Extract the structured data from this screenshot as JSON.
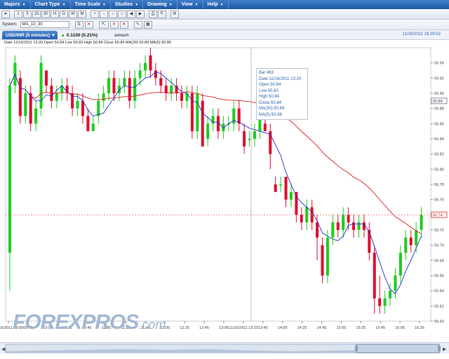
{
  "menu": {
    "items": [
      "Majors",
      "Chart Type",
      "Time Scale",
      "Studies",
      "Drawing",
      "View",
      "Help"
    ]
  },
  "toolbar": {
    "buttons": [
      "1",
      "5",
      "15",
      "30",
      "H",
      "D",
      "W",
      "M"
    ]
  },
  "system": {
    "label": "System:",
    "value": "MA_10_30"
  },
  "tabs": {
    "symbol": "USD/INR (5 minutes)",
    "change": "0.1100 (0.21%)",
    "user": "avinash",
    "timestamp": "11/16/2011 16:29:02"
  },
  "legend": {
    "text": "Date 11/16/2011 13:20  Open 50.84  Low 50.83  High 50.84  Close 50.84  MA(30) 50.89  MA(5) 50.86"
  },
  "tooltip": {
    "bar": "Bar:463",
    "date": "Date:11/16/2011 13:20",
    "open": "Open:50.84",
    "low": "Low:50.83",
    "high": "High:50.84",
    "close": "Close:50.84",
    "ma30": "MA(30):50.89",
    "ma5": "MA(5):50.86"
  },
  "logo": {
    "brand": "FOREXPROS",
    "suffix": ".com"
  },
  "chart_data": {
    "type": "candlestick",
    "y_axis_ticks": [
      "50.94",
      "50.92",
      "50.90",
      "50.88",
      "50.86",
      "50.84",
      "50.82",
      "50.80",
      "50.78",
      "50.76",
      "50.74",
      "50.72",
      "50.70",
      "50.68",
      "50.66",
      "50.64",
      "50.62",
      "50.60"
    ],
    "ylim": [
      50.6,
      50.96
    ],
    "current_price": "50.74",
    "crosshair_price": "50.89",
    "x_tick_labels": [
      "11/16/2011 09:00",
      "09:45",
      "10:05",
      "10:25",
      "10:45",
      "11:05",
      "11:25",
      "11:45",
      "12:05",
      "12:25",
      "12:45",
      "13:05",
      "11/16/2011 13:20",
      "13:45",
      "14:05",
      "14:25",
      "14:45",
      "15:05",
      "15:25",
      "15:45",
      "16:05",
      "16:25"
    ],
    "colors": {
      "up": "#22cc22",
      "down": "#dd1133",
      "ma5": "#2233cc",
      "ma30": "#dd2222"
    },
    "candles": [
      [
        50.69,
        50.91,
        50.64,
        50.92
      ],
      [
        50.91,
        50.94,
        50.9,
        50.95
      ],
      [
        50.92,
        50.87,
        50.86,
        50.93
      ],
      [
        50.87,
        50.9,
        50.86,
        50.91
      ],
      [
        50.9,
        50.86,
        50.85,
        50.91
      ],
      [
        50.86,
        50.88,
        50.85,
        50.89
      ],
      [
        50.88,
        50.94,
        50.87,
        50.95
      ],
      [
        50.93,
        50.91,
        50.9,
        50.93
      ],
      [
        50.91,
        50.89,
        50.88,
        50.92
      ],
      [
        50.89,
        50.9,
        50.88,
        50.91
      ],
      [
        50.9,
        50.91,
        50.89,
        50.92
      ],
      [
        50.91,
        50.9,
        50.89,
        50.92
      ],
      [
        50.9,
        50.88,
        50.87,
        50.91
      ],
      [
        50.88,
        50.89,
        50.87,
        50.9
      ],
      [
        50.89,
        50.87,
        50.86,
        50.9
      ],
      [
        50.87,
        50.85,
        50.85,
        50.88
      ],
      [
        50.85,
        50.86,
        50.85,
        50.87
      ],
      [
        50.87,
        50.89,
        50.86,
        50.9
      ],
      [
        50.89,
        50.9,
        50.88,
        50.91
      ],
      [
        50.9,
        50.92,
        50.89,
        50.93
      ],
      [
        50.92,
        50.9,
        50.89,
        50.93
      ],
      [
        50.9,
        50.91,
        50.89,
        50.92
      ],
      [
        50.91,
        50.92,
        50.9,
        50.93
      ],
      [
        50.92,
        50.89,
        50.88,
        50.93
      ],
      [
        50.89,
        50.92,
        50.88,
        50.93
      ],
      [
        50.92,
        50.93,
        50.91,
        50.94
      ],
      [
        50.93,
        50.94,
        50.92,
        50.95
      ],
      [
        50.95,
        50.93,
        50.92,
        50.96
      ],
      [
        50.93,
        50.92,
        50.91,
        50.94
      ],
      [
        50.92,
        50.91,
        50.9,
        50.93
      ],
      [
        50.91,
        50.9,
        50.89,
        50.92
      ],
      [
        50.9,
        50.91,
        50.89,
        50.92
      ],
      [
        50.91,
        50.9,
        50.89,
        50.92
      ],
      [
        50.9,
        50.89,
        50.88,
        50.91
      ],
      [
        50.89,
        50.9,
        50.88,
        50.91
      ],
      [
        50.9,
        50.85,
        50.84,
        50.91
      ],
      [
        50.85,
        50.9,
        50.84,
        50.91
      ],
      [
        50.89,
        50.83,
        50.83,
        50.9
      ],
      [
        50.84,
        50.86,
        50.83,
        50.87
      ],
      [
        50.86,
        50.87,
        50.85,
        50.88
      ],
      [
        50.87,
        50.85,
        50.84,
        50.88
      ],
      [
        50.85,
        50.86,
        50.84,
        50.87
      ],
      [
        50.86,
        50.86,
        50.85,
        50.87
      ],
      [
        50.86,
        50.88,
        50.85,
        50.89
      ],
      [
        50.88,
        50.86,
        50.85,
        50.89
      ],
      [
        50.85,
        50.83,
        50.82,
        50.86
      ],
      [
        50.84,
        50.84,
        50.83,
        50.85
      ],
      [
        50.84,
        50.85,
        50.83,
        50.86
      ],
      [
        50.85,
        50.87,
        50.84,
        50.88
      ],
      [
        50.86,
        50.85,
        50.85,
        50.87
      ],
      [
        50.85,
        50.82,
        50.8,
        50.86
      ],
      [
        50.78,
        50.77,
        50.77,
        50.79
      ],
      [
        50.78,
        50.78,
        50.77,
        50.79
      ],
      [
        50.79,
        50.76,
        50.75,
        50.79
      ],
      [
        50.76,
        50.77,
        50.75,
        50.78
      ],
      [
        50.77,
        50.74,
        50.73,
        50.77
      ],
      [
        50.74,
        50.73,
        50.72,
        50.75
      ],
      [
        50.73,
        50.75,
        50.72,
        50.76
      ],
      [
        50.75,
        50.73,
        50.72,
        50.76
      ],
      [
        50.73,
        50.71,
        50.68,
        50.74
      ],
      [
        50.7,
        50.66,
        50.65,
        50.71
      ],
      [
        50.66,
        50.71,
        50.65,
        50.72
      ],
      [
        50.71,
        50.73,
        50.7,
        50.74
      ],
      [
        50.73,
        50.72,
        50.71,
        50.74
      ],
      [
        50.72,
        50.74,
        50.71,
        50.75
      ],
      [
        50.74,
        50.73,
        50.72,
        50.75
      ],
      [
        50.73,
        50.72,
        50.71,
        50.74
      ],
      [
        50.72,
        50.73,
        50.71,
        50.74
      ],
      [
        50.73,
        50.72,
        50.71,
        50.74
      ],
      [
        50.72,
        50.69,
        50.68,
        50.73
      ],
      [
        50.69,
        50.63,
        50.61,
        50.7
      ],
      [
        50.63,
        50.62,
        50.61,
        50.66
      ],
      [
        50.62,
        50.63,
        50.61,
        50.64
      ],
      [
        50.63,
        50.64,
        50.62,
        50.65
      ],
      [
        50.64,
        50.66,
        50.63,
        50.67
      ],
      [
        50.66,
        50.69,
        50.65,
        50.7
      ],
      [
        50.69,
        50.71,
        50.68,
        50.72
      ],
      [
        50.71,
        50.7,
        50.69,
        50.72
      ],
      [
        50.7,
        50.72,
        50.69,
        50.73
      ],
      [
        50.72,
        50.74,
        50.71,
        50.75
      ]
    ]
  }
}
